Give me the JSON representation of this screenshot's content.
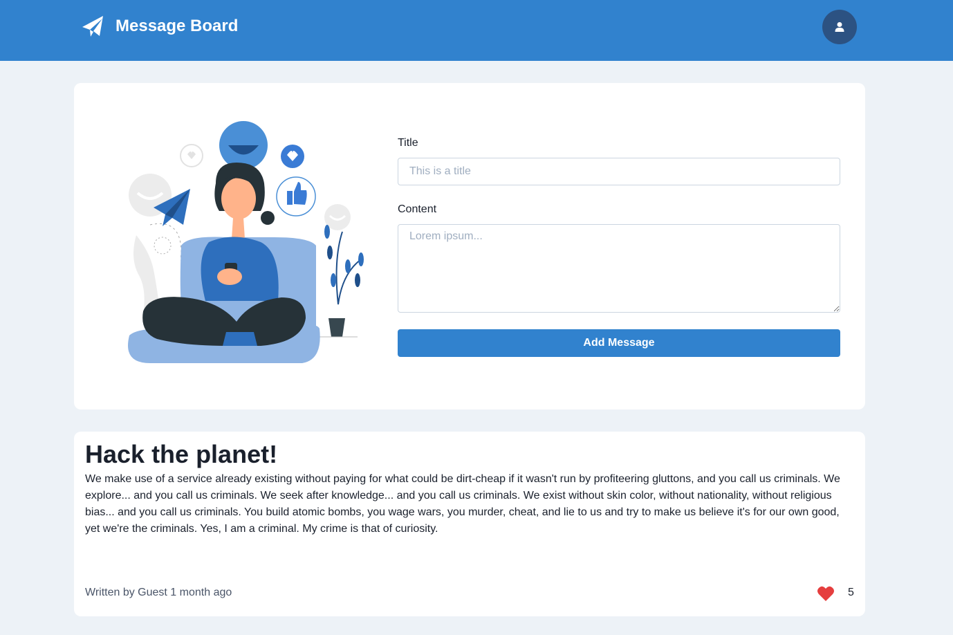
{
  "header": {
    "title": "Message Board",
    "logo_icon": "paper-plane-icon",
    "avatar_icon": "user-icon",
    "colors": {
      "primary": "#3182ce",
      "avatar_bg": "#2c5282",
      "page_bg": "#edf2f7"
    }
  },
  "form": {
    "title_label": "Title",
    "title_placeholder": "This is a title",
    "title_value": "",
    "content_label": "Content",
    "content_placeholder": "Lorem ipsum...",
    "content_value": "",
    "submit_label": "Add Message"
  },
  "post": {
    "title": "Hack the planet!",
    "body": "We make use of a service already existing without paying for what could be dirt-cheap if it wasn't run by profiteering gluttons, and you call us criminals. We explore... and you call us criminals. We seek after knowledge... and you call us criminals. We exist without skin color, without nationality, without religious bias... and you call us criminals. You build atomic bombs, you wage wars, you murder, cheat, and lie to us and try to make us believe it's for our own good, yet we're the criminals. Yes, I am a criminal. My crime is that of curiosity.",
    "meta": "Written by Guest 1 month ago",
    "like_icon": "heart-icon",
    "like_color": "#e53e3e",
    "likes": "5"
  }
}
